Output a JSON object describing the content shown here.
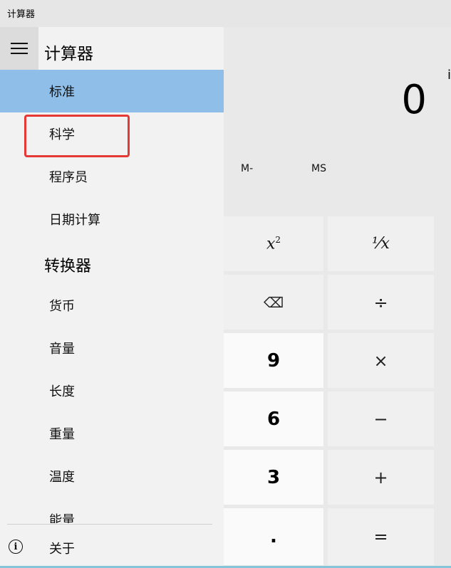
{
  "window": {
    "title": "计算器"
  },
  "display": {
    "value": "0",
    "edge_char": "i"
  },
  "memory": {
    "m_minus": "M-",
    "ms": "MS"
  },
  "keys": {
    "x_squared": {
      "base": "x",
      "sup": "2"
    },
    "reciprocal": "⅟x",
    "backspace": "⌫",
    "divide": "÷",
    "nine": "9",
    "multiply": "×",
    "six": "6",
    "minus": "−",
    "three": "3",
    "plus": "+",
    "decimal": ".",
    "equals": "="
  },
  "nav": {
    "title": "计算器",
    "calculator_items": [
      "标准",
      "科学",
      "程序员",
      "日期计算"
    ],
    "selected_index": 0,
    "converter_header": "转换器",
    "converter_items": [
      "货币",
      "音量",
      "长度",
      "重量",
      "温度",
      "能量"
    ],
    "about_label": "关于"
  },
  "colors": {
    "selected_bg": "#8fbfe8",
    "highlight_border": "#e53935",
    "nav_bg": "#f2f2f2",
    "keypad_bg": "#e9e9e9"
  }
}
